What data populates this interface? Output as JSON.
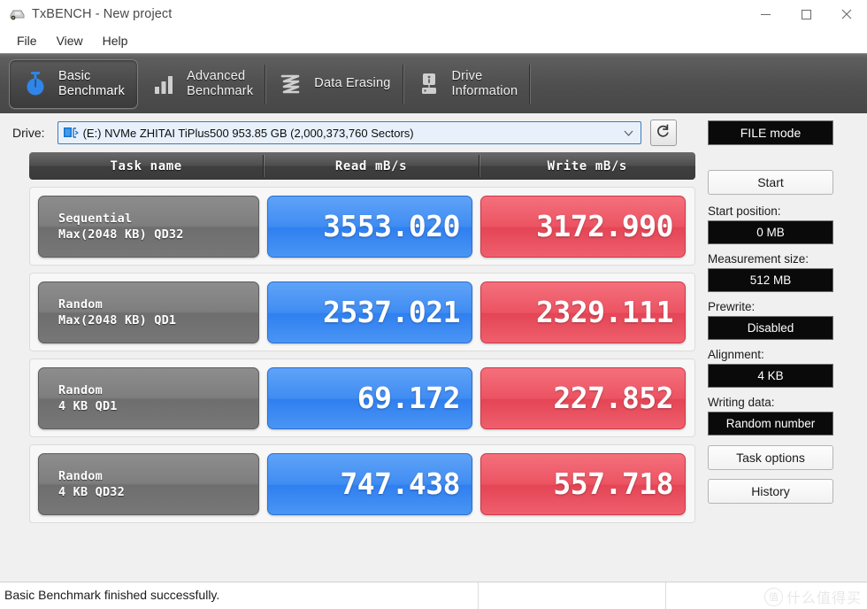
{
  "window": {
    "title": "TxBENCH - New project",
    "icon": "app-icon",
    "controls": {
      "minimize": "minimize-icon",
      "maximize": "maximize-icon",
      "close": "close-icon"
    }
  },
  "menu": {
    "items": [
      "File",
      "View",
      "Help"
    ]
  },
  "tabs": [
    {
      "label": "Basic\nBenchmark",
      "icon": "stopwatch-icon",
      "active": true
    },
    {
      "label": "Advanced\nBenchmark",
      "icon": "bar-chart-icon",
      "active": false
    },
    {
      "label": "Data Erasing",
      "icon": "shred-icon",
      "active": false
    },
    {
      "label": "Drive\nInformation",
      "icon": "drive-info-icon",
      "active": false
    }
  ],
  "drive": {
    "label": "Drive:",
    "value": "(E:) NVMe ZHITAI TiPlus500  953.85 GB (2,000,373,760 Sectors)",
    "icon": "drive-icon",
    "dropdown_icon": "chevron-down-icon",
    "refresh_icon": "refresh-icon"
  },
  "results": {
    "headers": [
      "Task name",
      "Read mB/s",
      "Write mB/s"
    ],
    "rows": [
      {
        "task_line1": "Sequential",
        "task_line2": "Max(2048 KB) QD32",
        "read": "3553.020",
        "write": "3172.990"
      },
      {
        "task_line1": "Random",
        "task_line2": "Max(2048 KB) QD1",
        "read": "2537.021",
        "write": "2329.111"
      },
      {
        "task_line1": "Random",
        "task_line2": "4 KB QD1",
        "read": "69.172",
        "write": "227.852"
      },
      {
        "task_line1": "Random",
        "task_line2": "4 KB QD32",
        "read": "747.438",
        "write": "557.718"
      }
    ]
  },
  "panel": {
    "mode": "FILE mode",
    "start": "Start",
    "start_position_label": "Start position:",
    "start_position": "0 MB",
    "measurement_size_label": "Measurement size:",
    "measurement_size": "512 MB",
    "prewrite_label": "Prewrite:",
    "prewrite": "Disabled",
    "alignment_label": "Alignment:",
    "alignment": "4 KB",
    "writing_data_label": "Writing data:",
    "writing_data": "Random number",
    "task_options": "Task options",
    "history": "History"
  },
  "status": {
    "text": "Basic Benchmark finished successfully."
  },
  "watermark": {
    "text": "什么值得买",
    "mark": "值"
  },
  "colors": {
    "read": "#3f8cf2",
    "write": "#ec5362",
    "tab_active_icon": "#2f86e8",
    "combo_border": "#3d7bbf"
  }
}
